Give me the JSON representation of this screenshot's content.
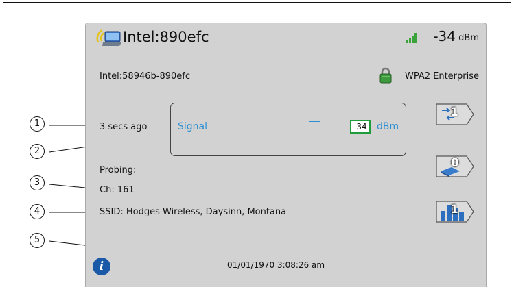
{
  "device": {
    "name": "Intel:890efc",
    "mac_label": "Intel:58946b-890efc",
    "rssi_value": "-34",
    "rssi_unit": "dBm",
    "security": "WPA2 Enterprise",
    "last_seen": "3 secs ago",
    "probing_label": "Probing:",
    "channel": "Ch: 161",
    "ssid": "SSID: Hodges Wireless, Daysinn, Montana",
    "timestamp": "01/01/1970 3:08:26 am"
  },
  "signal": {
    "label": "Signal",
    "value": "-34",
    "unit": "dBm"
  },
  "buttons": {
    "connections_count": "1",
    "probes_count": "0",
    "stats_count": "1"
  },
  "callouts": [
    "1",
    "2",
    "3",
    "4",
    "5"
  ],
  "icons": {
    "device": "laptop-wireless-icon",
    "signal_strength": "signal-bars-icon",
    "lock": "lock-icon",
    "info": "info-icon"
  },
  "colors": {
    "accent": "#2d8fd1",
    "signal_box_border": "#1f9d3a",
    "panel_bg": "#d2d2d2"
  }
}
